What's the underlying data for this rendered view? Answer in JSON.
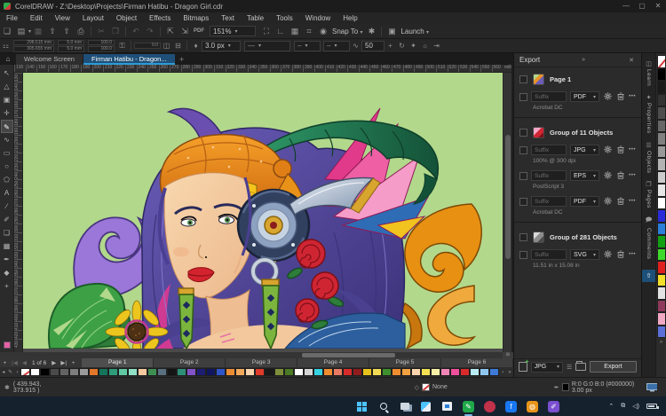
{
  "window": {
    "title": "CorelDRAW - Z:\\Desktop\\Projects\\Firman Hatibu - Dragon Girl.cdr"
  },
  "menus": [
    "File",
    "Edit",
    "View",
    "Layout",
    "Object",
    "Effects",
    "Bitmaps",
    "Text",
    "Table",
    "Tools",
    "Window",
    "Help"
  ],
  "toolbar": {
    "zoom_level": "151%",
    "snap_label": "Snap To",
    "launch_label": "Launch",
    "pdf_label": "PDF"
  },
  "property_bar": {
    "pos_x": "298.515 mm",
    "pos_y": "305.655 mm",
    "size_w": "5.0 mm",
    "size_h": "5.0 mm",
    "scale_x": "100.0",
    "scale_y": "100.0",
    "angle": "0.0",
    "outline_width": "3.0 px",
    "smoothing": "50"
  },
  "doc_tabs": {
    "welcome": "Welcome Screen",
    "active_doc": "Firman Hatibu - Dragon...",
    "units": "millimeters"
  },
  "rulers": {
    "h_start": 130,
    "h_step": 10,
    "h_count": 44,
    "v_start": 130,
    "v_step": 10,
    "v_count": 31
  },
  "toolbox": [
    {
      "name": "pick-tool",
      "glyph": "↖",
      "active": false
    },
    {
      "name": "shape-tool",
      "glyph": "△",
      "active": false
    },
    {
      "name": "crop-tool",
      "glyph": "▣",
      "active": false
    },
    {
      "name": "pan-tool",
      "glyph": "✛",
      "active": false
    },
    {
      "name": "curve-tool",
      "glyph": "✎",
      "active": true
    },
    {
      "name": "artistic-media-tool",
      "glyph": "∿",
      "active": false
    },
    {
      "name": "rectangle-tool",
      "glyph": "▭",
      "active": false
    },
    {
      "name": "ellipse-tool",
      "glyph": "○",
      "active": false
    },
    {
      "name": "polygon-tool",
      "glyph": "⬠",
      "active": false
    },
    {
      "name": "text-tool",
      "glyph": "A",
      "active": false
    },
    {
      "name": "dimension-tool",
      "glyph": "∕",
      "active": false
    },
    {
      "name": "connector-tool",
      "glyph": "✐",
      "active": false
    },
    {
      "name": "shadow-tool",
      "glyph": "❏",
      "active": false
    },
    {
      "name": "transparency-tool",
      "glyph": "▦",
      "active": false
    },
    {
      "name": "eyedropper-tool",
      "glyph": "✒",
      "active": false
    },
    {
      "name": "fill-tool",
      "glyph": "◆",
      "active": false
    },
    {
      "name": "add-tool",
      "glyph": "+",
      "active": false
    }
  ],
  "export_panel": {
    "title": "Export",
    "groups": [
      {
        "name": "Page 1",
        "rows": [
          {
            "suffix_placeholder": "Suffix",
            "format": "PDF",
            "note": "Acrobat DC"
          }
        ]
      },
      {
        "name": "Group of 11 Objects",
        "rows": [
          {
            "suffix_placeholder": "Suffix",
            "format": "JPG",
            "note": "100% @ 300 dpi"
          },
          {
            "suffix_placeholder": "Suffix",
            "format": "EPS",
            "note": "PostScript 3"
          },
          {
            "suffix_placeholder": "Suffix",
            "format": "PDF",
            "note": "Acrobat DC"
          }
        ]
      },
      {
        "name": "Group of 281 Objects",
        "rows": [
          {
            "suffix_placeholder": "Suffix",
            "format": "SVG",
            "note": "11.51 in x 15.08 in"
          }
        ]
      }
    ],
    "footer": {
      "format": "JPG",
      "export_label": "Export"
    }
  },
  "docker_tabs": [
    "Learn",
    "Properties",
    "Objects",
    "Pages",
    "Comments"
  ],
  "right_palette": [
    "none",
    "#000000",
    "#1a1a1a",
    "#333333",
    "#4d4d4d",
    "#666666",
    "#808080",
    "#999999",
    "#b3b3b3",
    "#cccccc",
    "#e6e6e6",
    "#ffffff",
    "#2b2bd9",
    "#2b7fd9",
    "#12a112",
    "#3fd92b",
    "#e01f1f",
    "#f2e02b",
    "#e3e3e3",
    "#8f3a5c",
    "#f2a9c4",
    "#5c6fd9"
  ],
  "bottom_palette": [
    "#ffffff",
    "#000000",
    "#4a4a4a",
    "#636363",
    "#7d7d7d",
    "#9b9b9b",
    "#e2762a",
    "#16745c",
    "#2f9d7a",
    "#5fc9a4",
    "#8fe0c4",
    "#f6c99f",
    "#3f8f52",
    "#5a6f80",
    "#141414",
    "#2d8f78",
    "#8153c6",
    "#1d1d71",
    "#10165e",
    "#2f55c9",
    "#ea8c33",
    "#f2a95c",
    "#f9d4ae",
    "#e03a2a",
    "#191919",
    "#7d8f3a",
    "#4a7a24",
    "#ffffff",
    "#d6d6d6",
    "#35d2e2",
    "#ef8c2f",
    "#ea7a62",
    "#d92b2b",
    "#8f1d1d",
    "#e8c21d",
    "#f2dc55",
    "#3f8f2f",
    "#ef8c2f",
    "#f2a042",
    "#f9d4ae",
    "#f2e055",
    "#f9f0a8",
    "#f285b8",
    "#ef4f9b",
    "#d92b2b",
    "#b8ecf2",
    "#8fc6ef",
    "#3f7ad9"
  ],
  "page_nav": {
    "counter": "1 of 6",
    "pages": [
      "Page 1",
      "Page 2",
      "Page 3",
      "Page 4",
      "Page 5",
      "Page 6"
    ],
    "active_page": "Page 1"
  },
  "status_bar": {
    "coords": "( 439.943, 373.915 )",
    "fill_label": "None",
    "outline_info": "R:0 G:0 B:0 (#000000)  3.00 px"
  },
  "colors": {
    "accent": "#2b9bd7",
    "canvas_bg": "#b2d88b",
    "panel_bg": "#2b2b2b",
    "taskbar_bg": "#16212e"
  }
}
